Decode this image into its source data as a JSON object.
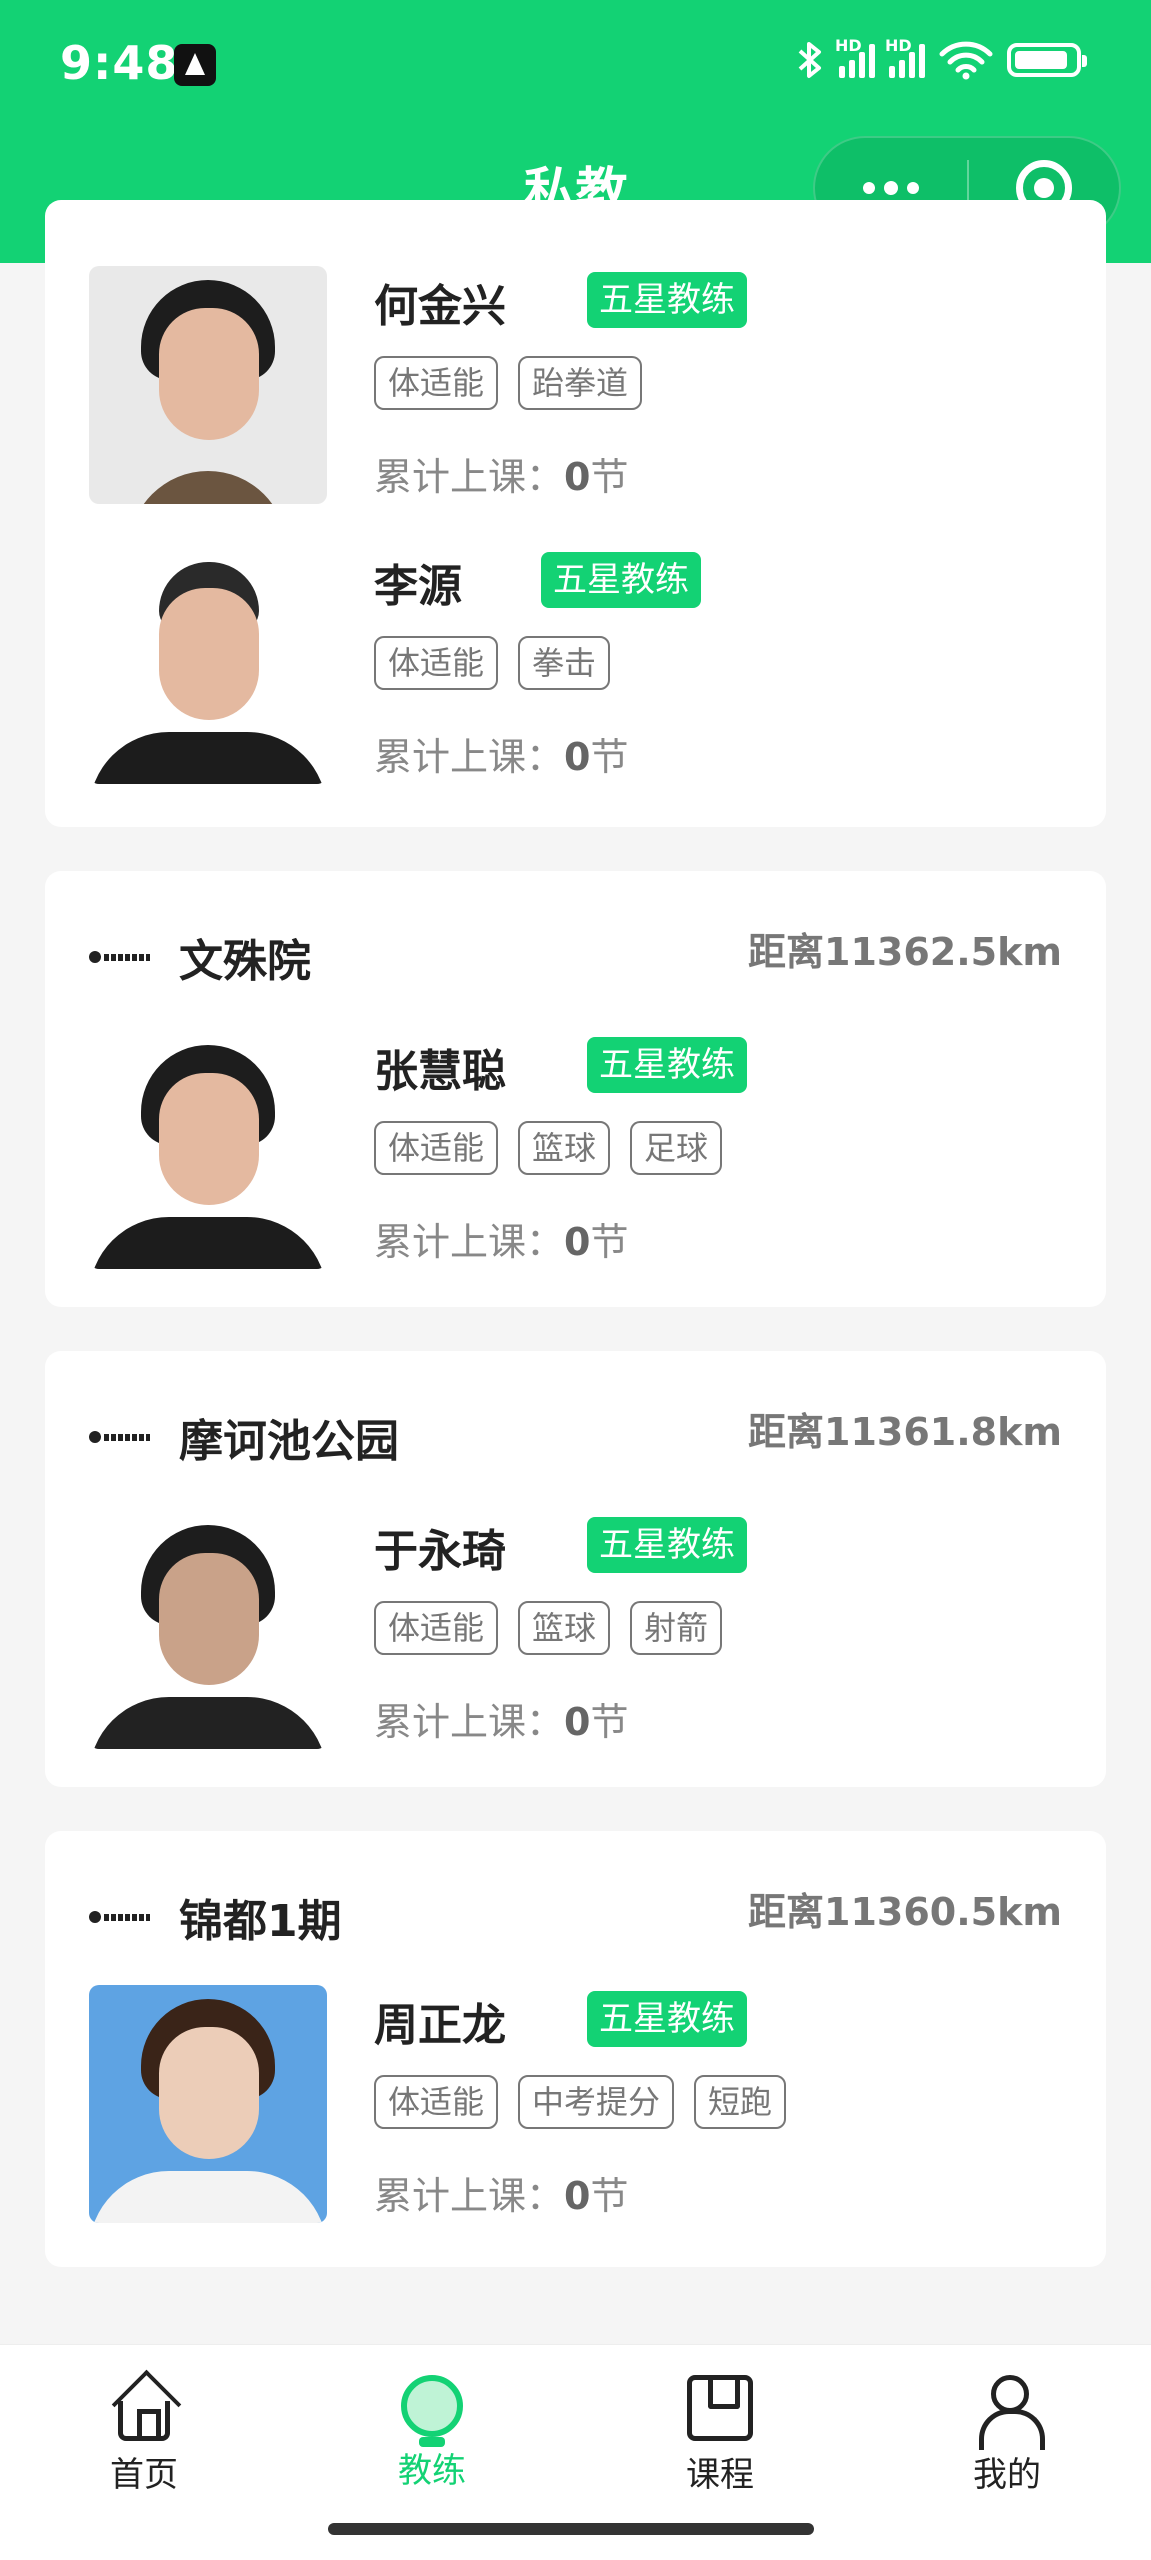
{
  "status_bar": {
    "time": "9:48",
    "hd1": "HD",
    "hd2": "HD"
  },
  "header": {
    "title": "私教"
  },
  "cards": [
    {
      "coaches": [
        {
          "name": "何金兴",
          "badge": "五星教练",
          "tags": [
            "体适能",
            "跆拳道"
          ],
          "lessons_label": "累计上课：",
          "lessons_value": "0",
          "lessons_unit": "节"
        },
        {
          "name": "李源",
          "badge": "五星教练",
          "tags": [
            "体适能",
            "拳击"
          ],
          "lessons_label": "累计上课：",
          "lessons_value": "0",
          "lessons_unit": "节"
        }
      ]
    },
    {
      "venue": "文殊院",
      "distance": "距离11362.5km",
      "coaches": [
        {
          "name": "张慧聪",
          "badge": "五星教练",
          "tags": [
            "体适能",
            "篮球",
            "足球"
          ],
          "lessons_label": "累计上课：",
          "lessons_value": "0",
          "lessons_unit": "节"
        }
      ]
    },
    {
      "venue": "摩诃池公园",
      "distance": "距离11361.8km",
      "coaches": [
        {
          "name": "于永琦",
          "badge": "五星教练",
          "tags": [
            "体适能",
            "篮球",
            "射箭"
          ],
          "lessons_label": "累计上课：",
          "lessons_value": "0",
          "lessons_unit": "节"
        }
      ]
    },
    {
      "venue": "锦都1期",
      "distance": "距离11360.5km",
      "coaches": [
        {
          "name": "周正龙",
          "badge": "五星教练",
          "tags": [
            "体适能",
            "中考提分",
            "短跑"
          ],
          "lessons_label": "累计上课：",
          "lessons_value": "0",
          "lessons_unit": "节"
        }
      ]
    }
  ],
  "tabbar": [
    {
      "label": "首页",
      "icon": "home-icon",
      "active": false
    },
    {
      "label": "教练",
      "icon": "bulb-icon",
      "active": true
    },
    {
      "label": "课程",
      "icon": "course-icon",
      "active": false
    },
    {
      "label": "我的",
      "icon": "person-icon",
      "active": false
    }
  ],
  "colors": {
    "brand": "#13d274",
    "text": "#222222",
    "muted": "#777777",
    "background": "#f5f5f5"
  }
}
